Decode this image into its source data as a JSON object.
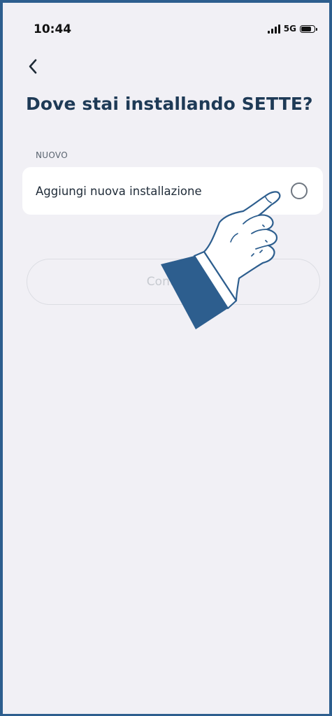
{
  "status_bar": {
    "time": "10:44",
    "network": "5G"
  },
  "header": {
    "back_icon": "chevron-left-icon",
    "title": "Dove stai installando SETTE?"
  },
  "section": {
    "label": "NUOVO",
    "option": {
      "label": "Aggiungi nuova installazione",
      "selected": false
    }
  },
  "footer": {
    "continue_label": "Continua",
    "continue_enabled": false
  },
  "colors": {
    "frame": "#2d5e8e",
    "title": "#1e3a56",
    "background": "#f1f0f5",
    "card": "#ffffff",
    "disabled_text": "#c7cad0"
  }
}
